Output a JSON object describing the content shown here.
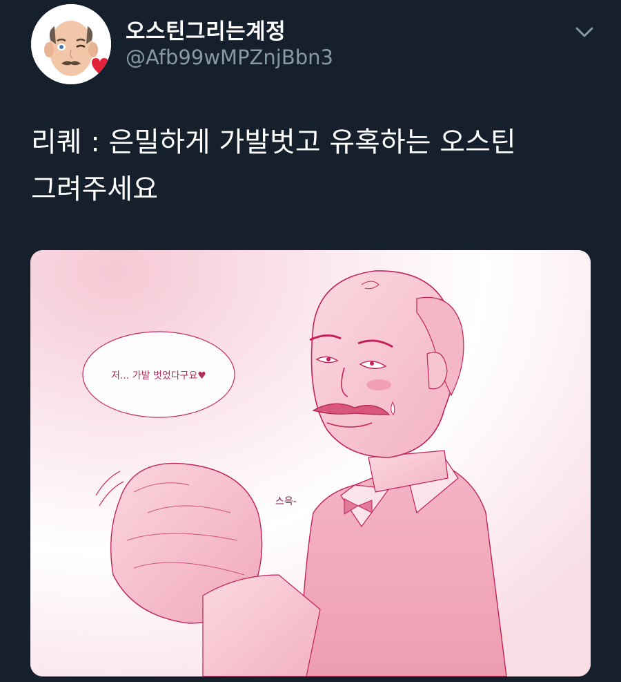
{
  "tweet": {
    "display_name": "오스틴그리는계정",
    "handle": "@Afb99wMPZnjBbn3",
    "text_line1": "리퀘 : 은밀하게 가발벗고 유혹하는 오스틴",
    "text_line2": "그려주세요"
  },
  "media": {
    "speech_bubble": "저... 가발 벗었다구요♥",
    "sound_effect": "스윽-"
  },
  "icons": {
    "avatar": "memoji-avatar-icon",
    "menu": "chevron-down-icon"
  },
  "colors": {
    "background": "#16202c",
    "handle": "#8899a6",
    "line_art": "#c2215a"
  }
}
